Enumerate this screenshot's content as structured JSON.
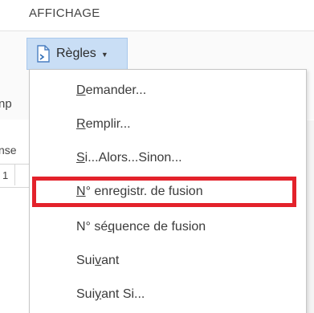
{
  "ribbon": {
    "tab_label": "AFFICHAGE"
  },
  "rules_button": {
    "label": "Règles",
    "icon": "document-rule-icon"
  },
  "background_fragments": {
    "left_text_1": "np",
    "left_text_2": "nse",
    "left_cell": "1"
  },
  "menu": {
    "items": [
      {
        "pre": "",
        "u": "D",
        "post": "emander..."
      },
      {
        "pre": "",
        "u": "R",
        "post": "emplir..."
      },
      {
        "pre": "",
        "u": "S",
        "post": "i...Alors...Sinon..."
      },
      {
        "pre": "",
        "u": "N",
        "post": "° enregistr. de fusion",
        "highlighted": true
      },
      {
        "pre": "N° sé",
        "u": "q",
        "post": "uence de fusion"
      },
      {
        "pre": "Sui",
        "u": "v",
        "post": "ant"
      },
      {
        "pre": "Sui",
        "u": "y",
        "post": "ant Si..."
      }
    ]
  },
  "colors": {
    "button_bg": "#c9def5",
    "highlight_border": "#e3222b"
  }
}
